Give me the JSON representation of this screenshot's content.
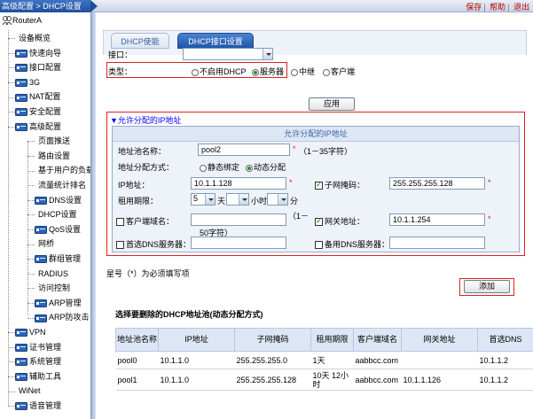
{
  "header": {
    "breadcrumb": "高级配置 > DHCP设置",
    "links": [
      "保存",
      "帮助",
      "退出"
    ]
  },
  "sidebar": {
    "root": "RouterA",
    "items": [
      {
        "label": "设备概览",
        "icon": "none"
      },
      {
        "label": "快速向导",
        "icon": "folder-icon"
      },
      {
        "label": "接口配置",
        "icon": "folder-icon"
      },
      {
        "label": "3G",
        "icon": "folder-icon"
      },
      {
        "label": "NAT配置",
        "icon": "folder-icon"
      },
      {
        "label": "安全配置",
        "icon": "folder-icon"
      },
      {
        "label": "高级配置",
        "icon": "folder-open-icon"
      },
      {
        "label": "页面推送",
        "icon": "none",
        "sub": true
      },
      {
        "label": "路由设置",
        "icon": "none",
        "sub": true
      },
      {
        "label": "基于用户的负载",
        "icon": "none",
        "sub": true
      },
      {
        "label": "流量统计排名",
        "icon": "none",
        "sub": true
      },
      {
        "label": "DNS设置",
        "icon": "folder-icon",
        "sub": true
      },
      {
        "label": "DHCP设置",
        "icon": "none",
        "sub": true
      },
      {
        "label": "QoS设置",
        "icon": "folder-icon",
        "sub": true
      },
      {
        "label": "网桥",
        "icon": "none",
        "sub": true
      },
      {
        "label": "群组管理",
        "icon": "folder-icon",
        "sub": true
      },
      {
        "label": "RADIUS",
        "icon": "none",
        "sub": true
      },
      {
        "label": "访问控制",
        "icon": "none",
        "sub": true
      },
      {
        "label": "ARP管理",
        "icon": "folder-icon",
        "sub": true
      },
      {
        "label": "ARP防攻击",
        "icon": "folder-icon",
        "sub": true
      },
      {
        "label": "VPN",
        "icon": "folder-icon"
      },
      {
        "label": "证书管理",
        "icon": "folder-icon"
      },
      {
        "label": "系统管理",
        "icon": "folder-icon"
      },
      {
        "label": "辅助工具",
        "icon": "folder-icon"
      },
      {
        "label": "WiNet",
        "icon": "none"
      },
      {
        "label": "语音管理",
        "icon": "folder-icon"
      }
    ]
  },
  "tabs": [
    {
      "label": "DHCP使能",
      "active": false
    },
    {
      "label": "DHCP接口设置",
      "active": true
    }
  ],
  "form": {
    "interface_label": "接口：",
    "interface_value": "",
    "type_label": "类型：",
    "type_options": [
      "不启用DHCP",
      "服务器",
      "中继",
      "客户端"
    ],
    "type_selected": "服务器",
    "apply_label": "应用"
  },
  "pool_section": {
    "title": "▼允许分配的IP地址",
    "header": "允许分配的IP地址",
    "pool_name_label": "地址池名称：",
    "pool_name_value": "pool2",
    "pool_name_hint": "（1－35字符）",
    "alloc_label": "地址分配方式：",
    "alloc_options": [
      "静态绑定",
      "动态分配"
    ],
    "alloc_selected": "动态分配",
    "ip_label": "IP地址：",
    "ip_value": "10.1.1.128",
    "mask_label": "子网掩码：",
    "mask_value": "255.255.255.128",
    "lease_label": "租用期限：",
    "lease_days": "5",
    "days_unit": "天",
    "hours_unit": "小时",
    "minutes_unit": "分",
    "client_domain_label": "客户端域名：",
    "client_domain_value": "",
    "client_domain_hint_1": "（1－",
    "client_domain_hint_2": "50字符）",
    "gateway_label": "网关地址：",
    "gateway_value": "10.1.1.254",
    "dns1_label": "首选DNS服务器：",
    "dns2_label": "备用DNS服务器：",
    "required_star": "*"
  },
  "note": "星号（*）为必须填写项",
  "add_label": "添加",
  "table": {
    "title": "选择要删除的DHCP地址池(动态分配方式)",
    "columns": [
      "地址池名称",
      "IP地址",
      "子网掩码",
      "租用期限",
      "客户端域名",
      "网关地址",
      "首选DNS"
    ],
    "rows": [
      [
        "pool0",
        "10.1.1.0",
        "255.255.255.0",
        "1天",
        "aabbcc.com",
        "",
        "10.1.1.2"
      ],
      [
        "pool1",
        "10.1.1.0",
        "255.255.255.128",
        "10天 12小时",
        "aabbcc.com",
        "10.1.1.126",
        "10.1.1.2"
      ]
    ]
  },
  "colors": {
    "accent": "#1f56a8",
    "highlight_box": "#dd2222",
    "link": "#bb0000"
  }
}
